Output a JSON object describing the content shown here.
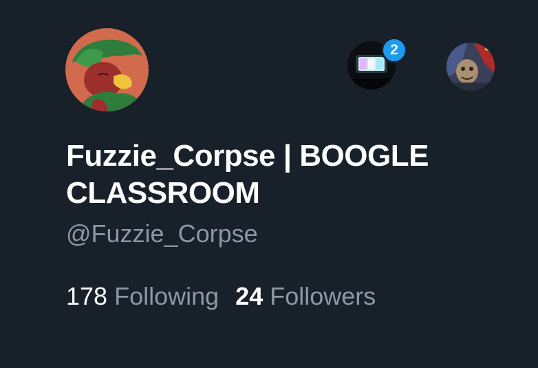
{
  "profile": {
    "display_name": "Fuzzie_Corpse | BOOGLE CLASSROOM",
    "handle": "@Fuzzie_Corpse"
  },
  "accounts": {
    "notification_count": "2"
  },
  "stats": {
    "following_count": "178",
    "following_label": "Following",
    "followers_count": "24",
    "followers_label": "Followers"
  },
  "colors": {
    "background": "#18202a",
    "primary_text": "#ffffff",
    "secondary_text": "#8b98a5",
    "badge": "#1d9bf0"
  }
}
